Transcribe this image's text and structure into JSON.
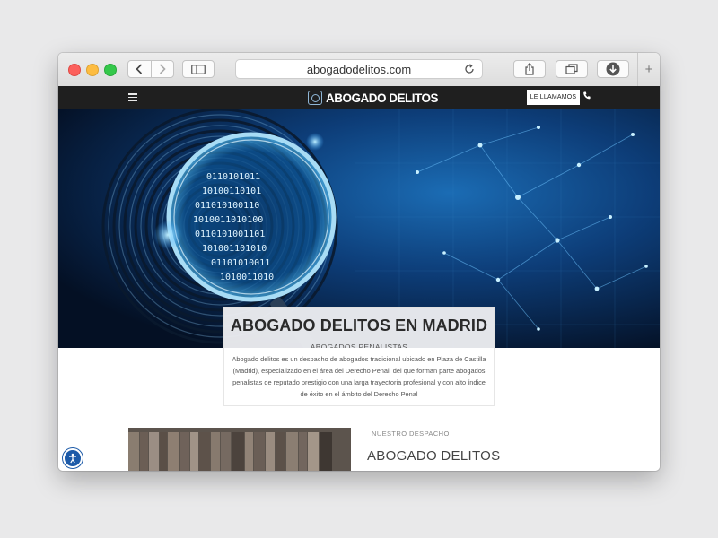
{
  "browser": {
    "url": "abogadodelitos.com",
    "new_tab_label": "+"
  },
  "site": {
    "logo_text": "ABOGADO DELITOS",
    "call_button": "LE LLAMAMOS",
    "hero_binary": [
      "0110101011",
      "10100110101",
      "011010100110",
      "1010011010100",
      "0110101001101",
      "101001101010",
      "01101010011",
      "1010011010"
    ]
  },
  "intro": {
    "title": "ABOGADO DELITOS EN MADRID",
    "subtitle": "ABOGADOS PENALISTAS",
    "description": "Abogado delitos es un despacho de abogados tradicional ubicado en Plaza de Castilla (Madrid), especializado en el área del Derecho Penal, del que forman parte abogados penalistas de reputado prestigio con una larga trayectoria profesional y con alto índice de éxito en el ámbito del Derecho Penal"
  },
  "section": {
    "label": "NUESTRO DESPACHO",
    "title": "ABOGADO DELITOS"
  },
  "colors": {
    "nav_bg": "#1f1f1f",
    "hero_bg": "#081b37",
    "accent_blue": "#1c5aa8"
  }
}
